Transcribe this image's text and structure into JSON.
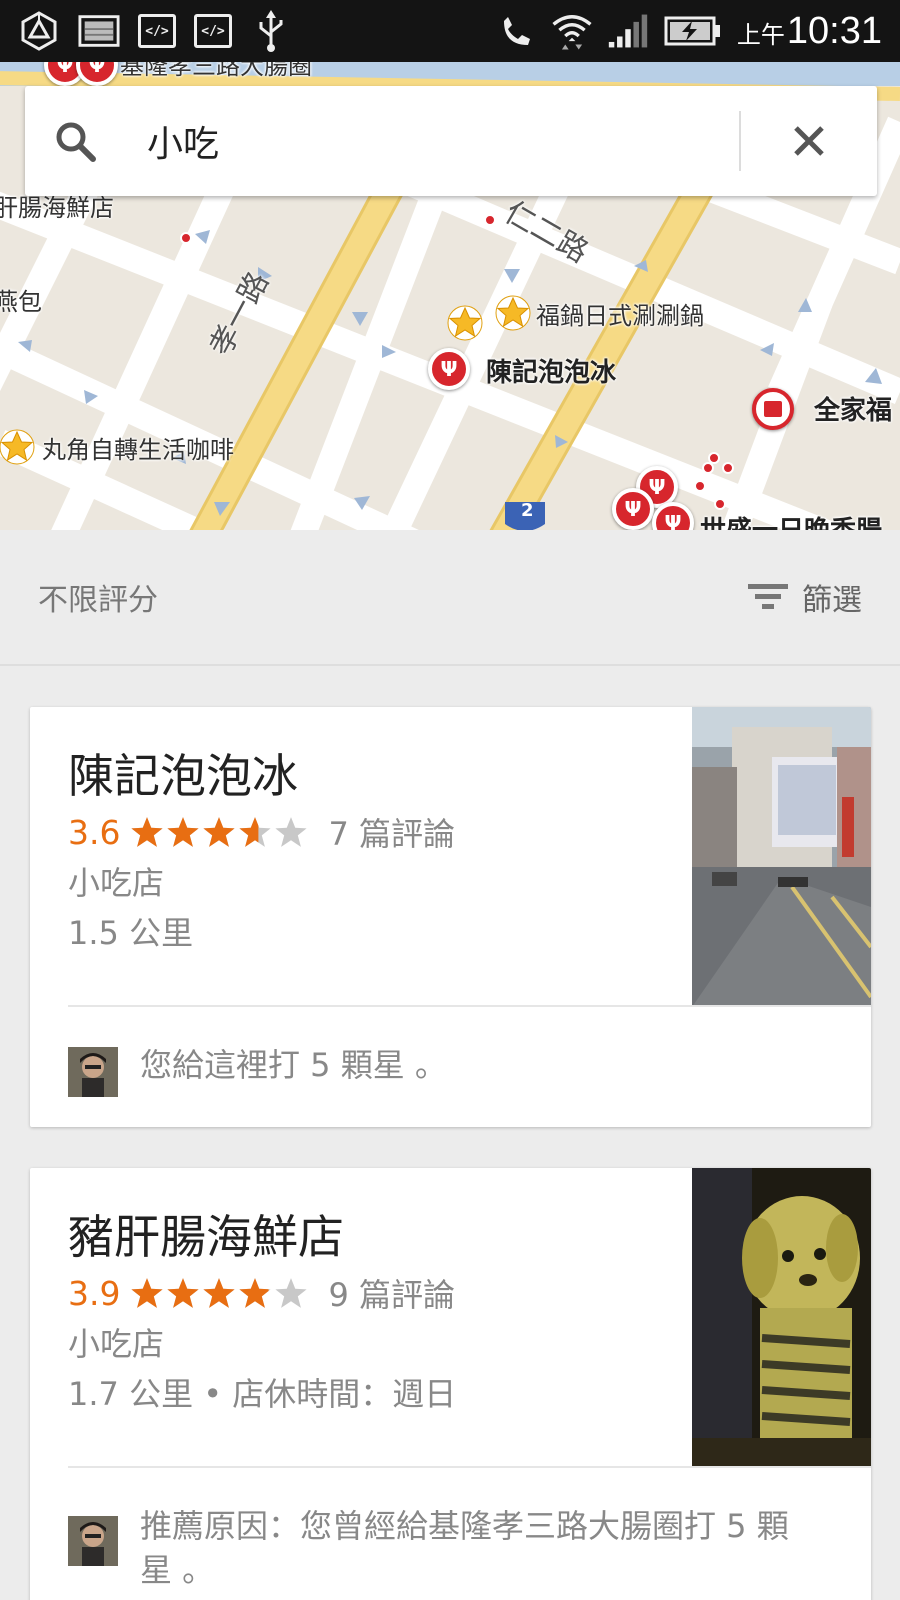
{
  "status_bar": {
    "ampm": "上午",
    "time": "10:31",
    "left_icons": [
      "ingress-icon",
      "image-notification-icon",
      "code-icon",
      "code-icon",
      "usb-icon"
    ],
    "right_icons": [
      "no-call-icon",
      "wifi-icon",
      "signal-icon",
      "battery-charging-icon"
    ],
    "code_label": "</>"
  },
  "map": {
    "labels": {
      "top_cut": "基隆孝三路大腸圈",
      "left_shop": "肝腸海鮮店",
      "left_bread": "燕包",
      "hotpot": "福鍋日式涮涮鍋",
      "ice": "陳記泡泡冰",
      "familymart": "全家福",
      "cafe": "丸角自轉生活咖啡",
      "bottom_right": "世盛一日晚香腸",
      "road_xiao1": "孝一路",
      "road_ren2": "仁二路",
      "route_badge": "2"
    }
  },
  "search": {
    "query": "小吃"
  },
  "filter": {
    "rating_label": "不限評分",
    "filter_label": "篩選"
  },
  "results": [
    {
      "name": "陳記泡泡冰",
      "rating": "3.6",
      "rating_value": 3.6,
      "reviews": "7 篇評論",
      "category": "小吃店",
      "detail": "1.5 公里",
      "note": "您給這裡打 5 顆星 。"
    },
    {
      "name": "豬肝腸海鮮店",
      "rating": "3.9",
      "rating_value": 3.9,
      "reviews": "9 篇評論",
      "category": "小吃店",
      "detail": "1.7 公里 • 店休時間：週日",
      "note": "推薦原因：您曾經給基隆孝三路大腸圈打 5 顆星 。"
    }
  ],
  "colors": {
    "rating_orange": "#e86e12",
    "star_orange": "#e86e12",
    "star_empty": "#c8c8c8",
    "pin_red": "#d7262d",
    "major_road": "#f5d57a"
  }
}
